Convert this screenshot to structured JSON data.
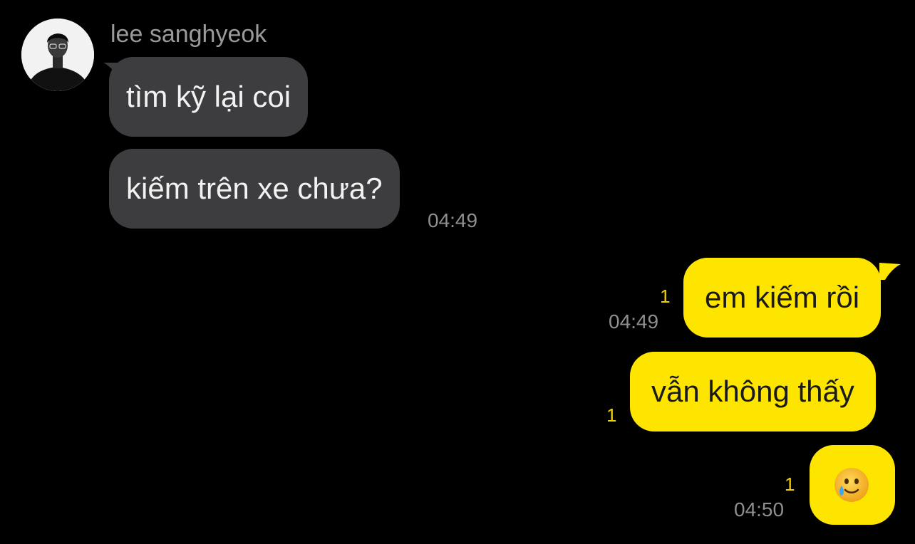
{
  "chat": {
    "sender_name": "lee sanghyeok",
    "messages": [
      {
        "direction": "in",
        "text": "tìm kỹ lại coi"
      },
      {
        "direction": "in",
        "text": "kiếm trên xe chưa?",
        "time": "04:49"
      },
      {
        "direction": "out",
        "text": "em kiếm rồi",
        "time": "04:49",
        "unread": "1"
      },
      {
        "direction": "out",
        "text": "vẫn không thấy",
        "unread": "1"
      },
      {
        "direction": "out",
        "emoji": "crying-smile-face",
        "time": "04:50",
        "unread": "1"
      }
    ]
  },
  "colors": {
    "background": "#000000",
    "incoming_bubble": "#3d3d3f",
    "outgoing_bubble": "#fee500",
    "unread_count": "#f0d200",
    "timestamp": "#8f8f8f"
  },
  "icons": {
    "avatar": "profile-photo",
    "emoji": "crying-smile-face"
  }
}
